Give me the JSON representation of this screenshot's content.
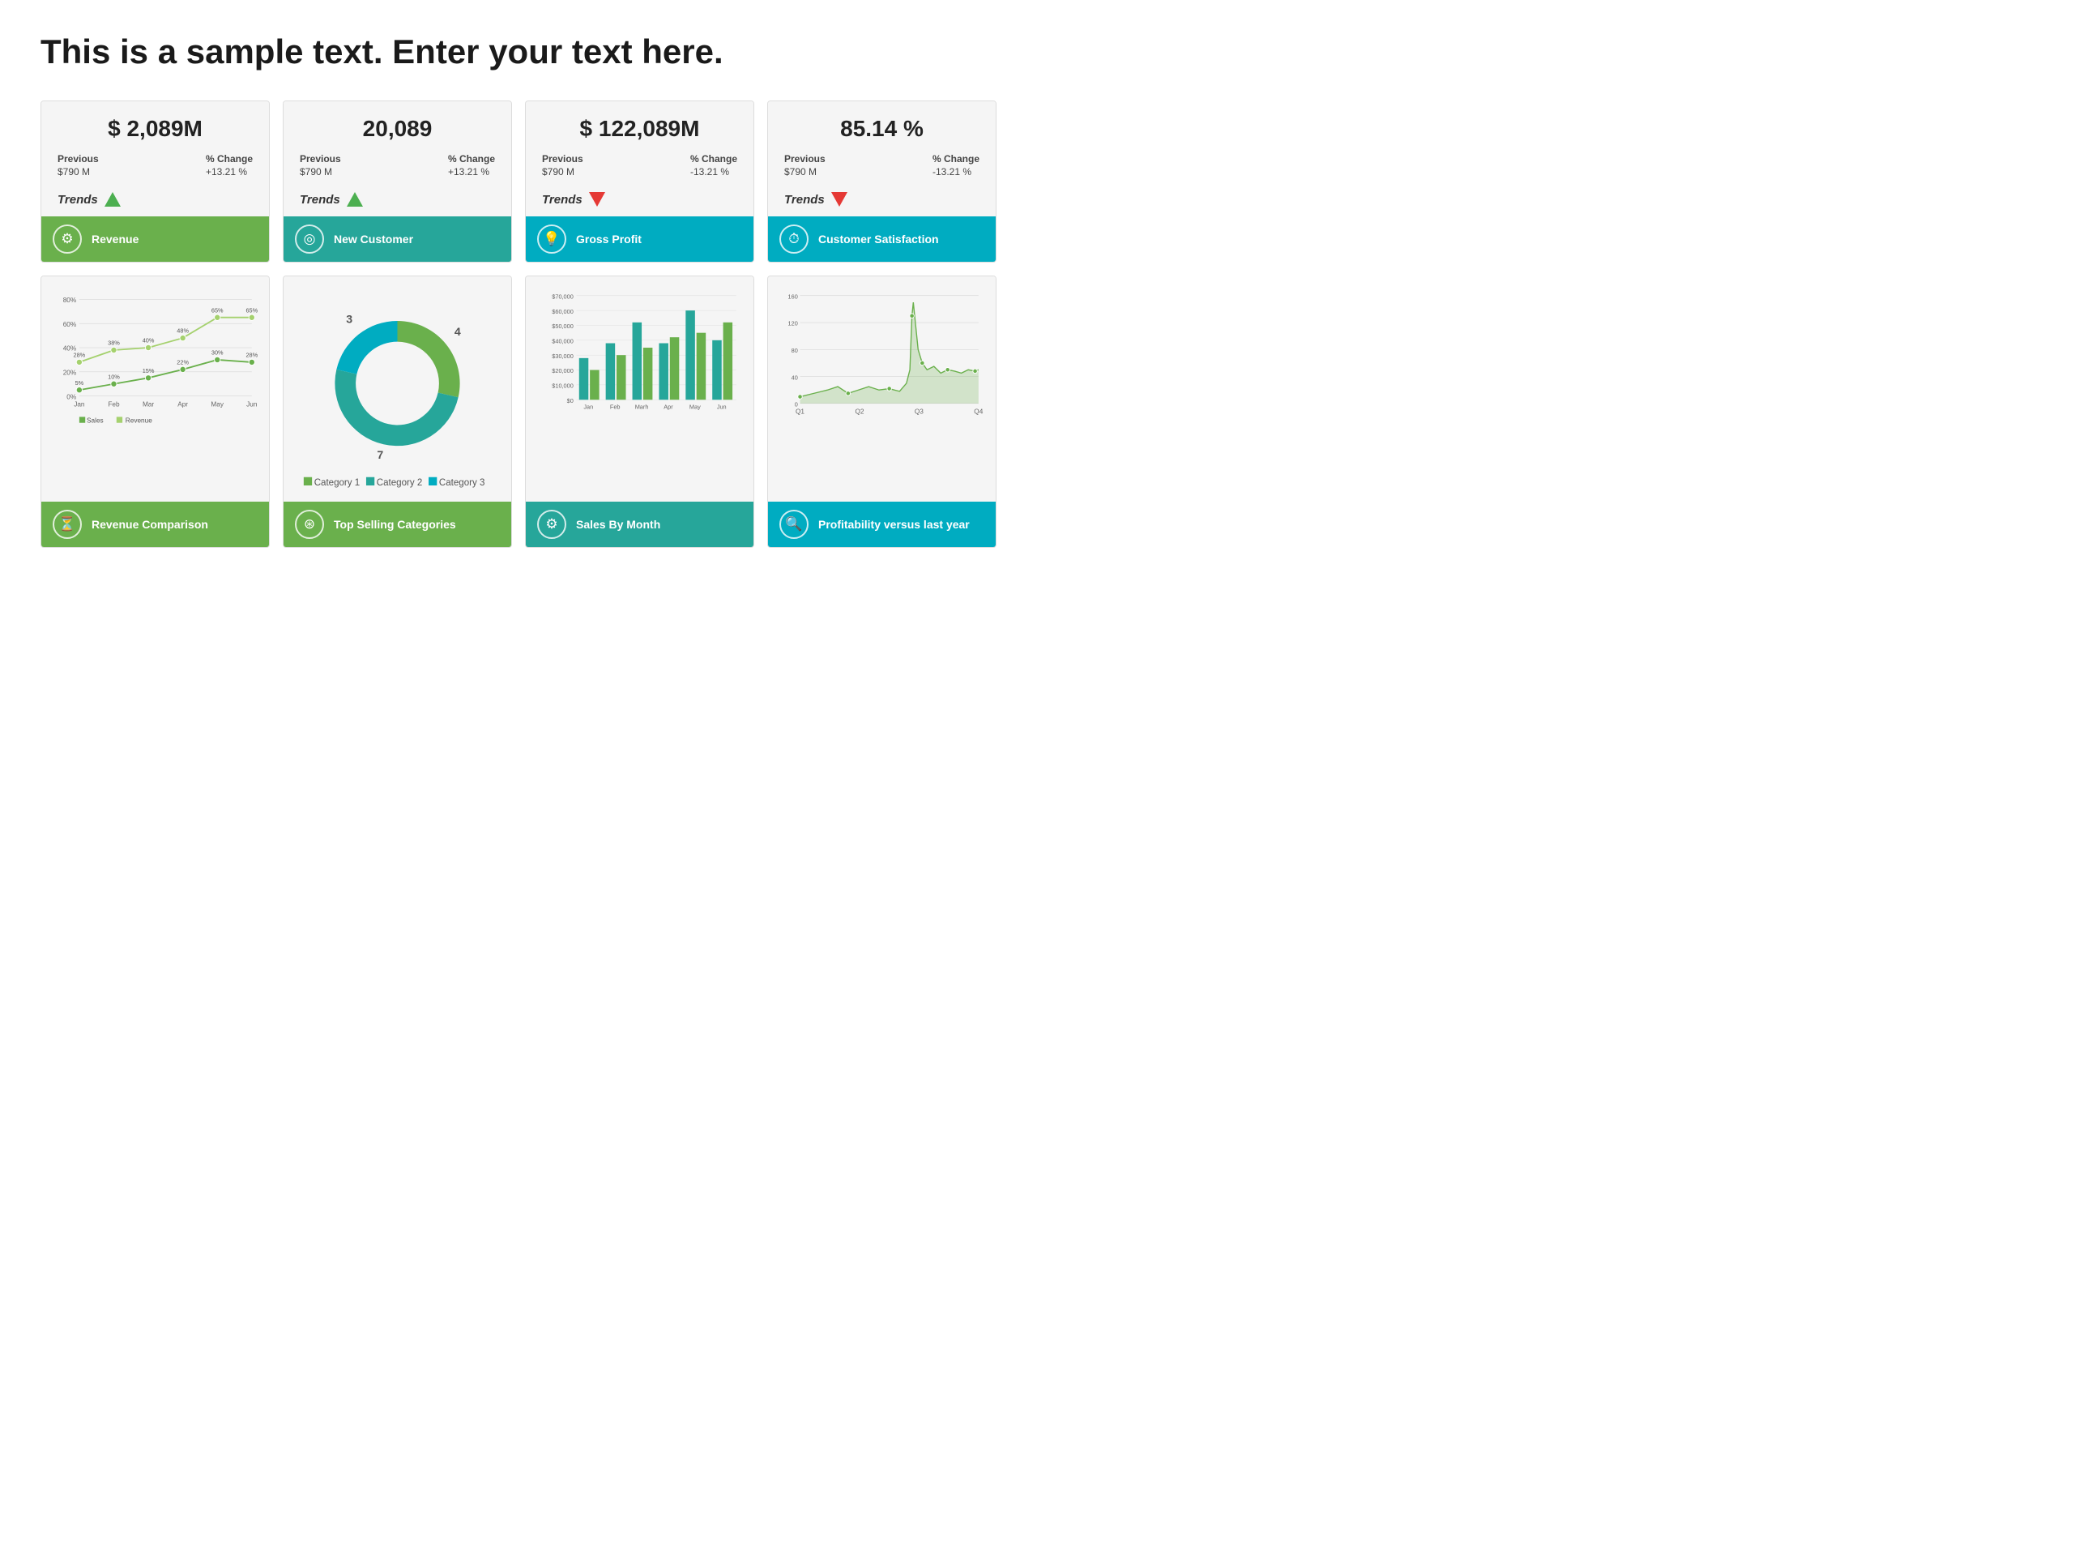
{
  "title": "This is a sample text. Enter your text here.",
  "kpi_cards": [
    {
      "id": "revenue",
      "value": "$ 2,089M",
      "previous_label": "Previous",
      "previous_value": "$790 M",
      "change_label": "% Change",
      "change_value": "+13.21 %",
      "trend": "up",
      "trend_label": "Trends",
      "footer_label": "Revenue",
      "footer_color": "green",
      "footer_icon": "⚙"
    },
    {
      "id": "new-customer",
      "value": "20,089",
      "previous_label": "Previous",
      "previous_value": "$790 M",
      "change_label": "% Change",
      "change_value": "+13.21 %",
      "trend": "up",
      "trend_label": "Trends",
      "footer_label": "New Customer",
      "footer_color": "teal",
      "footer_icon": "◎"
    },
    {
      "id": "gross-profit",
      "value": "$ 122,089M",
      "previous_label": "Previous",
      "previous_value": "$790 M",
      "change_label": "% Change",
      "change_value": "-13.21 %",
      "trend": "down",
      "trend_label": "Trends",
      "footer_label": "Gross Profit",
      "footer_color": "blue-teal",
      "footer_icon": "💡"
    },
    {
      "id": "customer-satisfaction",
      "value": "85.14 %",
      "previous_label": "Previous",
      "previous_value": "$790 M",
      "change_label": "% Change",
      "change_value": "-13.21 %",
      "trend": "down",
      "trend_label": "Trends",
      "footer_label": "Customer Satisfaction",
      "footer_color": "blue-teal",
      "footer_icon": "⏱"
    }
  ],
  "chart_cards": [
    {
      "id": "revenue-comparison",
      "footer_label": "Revenue Comparison",
      "footer_color": "green",
      "footer_icon": "⏳",
      "type": "line"
    },
    {
      "id": "top-selling-categories",
      "footer_label": "Top Selling Categories",
      "footer_color": "green",
      "footer_icon": "⊛",
      "type": "donut"
    },
    {
      "id": "sales-by-month",
      "footer_label": "Sales By Month",
      "footer_color": "teal",
      "footer_icon": "⚙",
      "type": "bar"
    },
    {
      "id": "profitability",
      "footer_label": "Profitability versus last year",
      "footer_color": "blue-teal",
      "footer_icon": "🔍",
      "type": "area"
    }
  ],
  "line_chart": {
    "labels": [
      "Jan",
      "Feb",
      "Mar",
      "Apr",
      "May",
      "Jun"
    ],
    "sales": [
      5,
      10,
      15,
      22,
      30,
      28
    ],
    "revenue": [
      28,
      38,
      40,
      48,
      65,
      65
    ],
    "y_labels": [
      "0%",
      "20%",
      "40%",
      "60%",
      "80%"
    ],
    "legend": [
      "Sales",
      "Revenue"
    ]
  },
  "donut_chart": {
    "segments": [
      {
        "label": "Category 1",
        "value": 4,
        "color": "#6ab04c"
      },
      {
        "label": "Category 2",
        "value": 7,
        "color": "#26a69a"
      },
      {
        "label": "Category 3",
        "value": 3,
        "color": "#00acc1"
      }
    ]
  },
  "bar_chart": {
    "labels": [
      "Jan",
      "Feb",
      "Marh",
      "Apr",
      "May",
      "Jun"
    ],
    "series1": [
      28000,
      38000,
      52000,
      38000,
      60000,
      40000
    ],
    "series2": [
      20000,
      30000,
      35000,
      42000,
      45000,
      52000
    ],
    "y_labels": [
      "$0",
      "$10,000",
      "$20,000",
      "$30,000",
      "$40,000",
      "$50,000",
      "$60,000",
      "$70,000"
    ]
  },
  "area_chart": {
    "labels": [
      "Q1",
      "Q2",
      "Q3",
      "Q4"
    ],
    "y_labels": [
      "0",
      "40",
      "80",
      "120",
      "160"
    ]
  }
}
